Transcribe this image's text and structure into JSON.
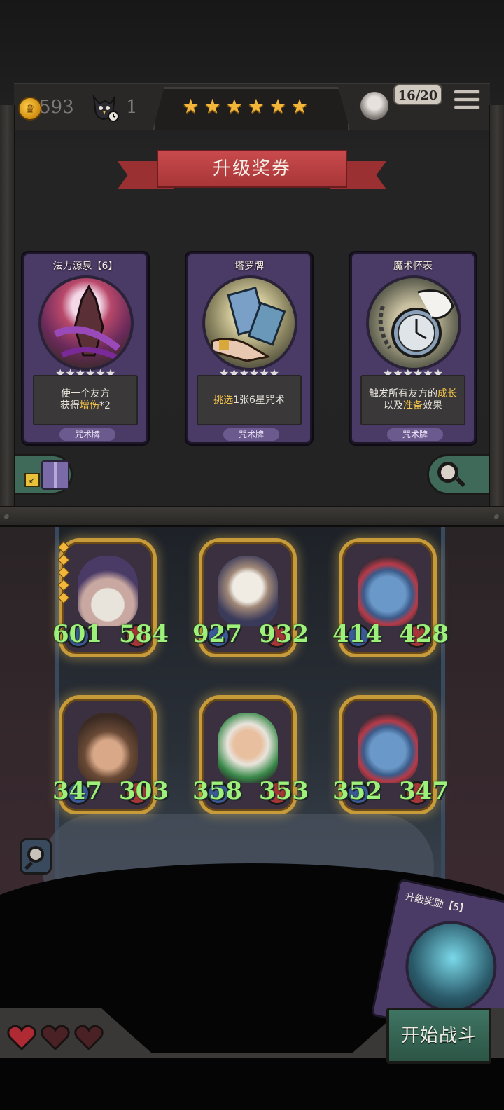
{
  "hud": {
    "gold": "593",
    "crow_count": "1",
    "stars": [
      "★",
      "★",
      "★",
      "★",
      "★",
      "★"
    ],
    "board_count": "16/20"
  },
  "shop": {
    "title": "升级奖券",
    "cards": [
      {
        "title": "法力源泉【6】",
        "stars": "★★★★★★",
        "desc_pre": "使一个友方\n获得",
        "desc_hl": "增伤",
        "desc_post": "*2",
        "type": "咒术牌"
      },
      {
        "title": "塔罗牌",
        "stars": "★★★★★★",
        "desc_hl": "挑选",
        "desc_post": "1张6星咒术",
        "type": "咒术牌"
      },
      {
        "title": "魔术怀表",
        "stars": "★★★★★★",
        "desc_pre": "触发所有友方的",
        "desc_hl": "成长",
        "desc_mid": "以及",
        "desc_hl2": "准备",
        "desc_post": "效果",
        "type": "咒术牌"
      }
    ]
  },
  "board": {
    "heroes": [
      {
        "atk": "601",
        "hp": "584"
      },
      {
        "atk": "927",
        "hp": "932"
      },
      {
        "atk": "414",
        "hp": "428"
      },
      {
        "atk": "347",
        "hp": "303"
      },
      {
        "atk": "358",
        "hp": "353"
      },
      {
        "atk": "352",
        "hp": "347"
      }
    ],
    "upgrade_reward_title": "升级奖励【5】",
    "start_button": "开始战斗",
    "lives": 3
  },
  "colors": {
    "accent_gold": "#f2b63a",
    "stat_green": "#9df07a",
    "ribbon_red": "#b83e40",
    "card_purple": "#4a3a66",
    "button_green": "#3f7462"
  }
}
